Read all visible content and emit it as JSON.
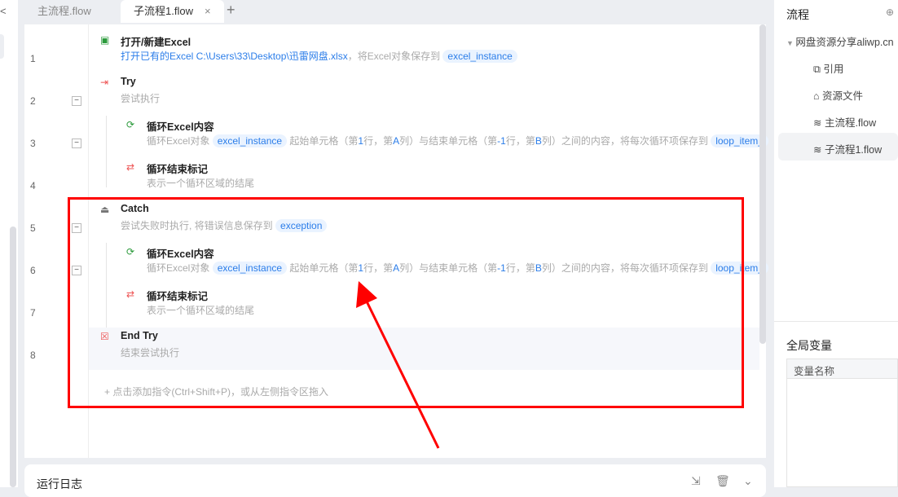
{
  "tabs": [
    {
      "label": "主流程.flow"
    },
    {
      "label": "子流程1.flow",
      "close": "×"
    }
  ],
  "add_tab": "+",
  "back": "<",
  "rows": [
    {
      "n": "1",
      "title": "打开/新建Excel",
      "desc": [
        {
          "t": "打开已有的Excel C:\\Users\\33\\Desktop\\迅雷网盘.xlsx",
          "k": "blue"
        },
        {
          "t": "，将Excel对象保存到 ",
          "k": ""
        },
        {
          "t": "excel_instance",
          "k": "chip"
        }
      ]
    },
    {
      "n": "2",
      "title": "Try",
      "desc": [
        {
          "t": "尝试执行",
          "k": ""
        }
      ]
    },
    {
      "n": "3",
      "title": "循环Excel内容",
      "desc": [
        {
          "t": "循环Excel对象 ",
          "k": ""
        },
        {
          "t": "excel_instance",
          "k": "chip"
        },
        {
          "t": " 起始单元格（第",
          "k": ""
        },
        {
          "t": "1",
          "k": "blue"
        },
        {
          "t": "行，第",
          "k": ""
        },
        {
          "t": "A",
          "k": "blue"
        },
        {
          "t": "列）与结束单元格（第",
          "k": ""
        },
        {
          "t": "-1",
          "k": "blue"
        },
        {
          "t": "行，第",
          "k": ""
        },
        {
          "t": "B",
          "k": "blue"
        },
        {
          "t": "列）之间的内容，将每次循环项保存到 ",
          "k": ""
        },
        {
          "t": "loop_item_",
          "k": "chip"
        }
      ]
    },
    {
      "n": "4",
      "title": "循环结束标记",
      "desc": [
        {
          "t": "表示一个循环区域的结尾",
          "k": ""
        }
      ]
    },
    {
      "n": "5",
      "title": "Catch",
      "desc": [
        {
          "t": "尝试失败时执行, 将错误信息保存到 ",
          "k": ""
        },
        {
          "t": "exception",
          "k": "chip"
        }
      ]
    },
    {
      "n": "6",
      "title": "循环Excel内容",
      "desc": [
        {
          "t": "循环Excel对象 ",
          "k": ""
        },
        {
          "t": "excel_instance",
          "k": "chip"
        },
        {
          "t": " 起始单元格（第",
          "k": ""
        },
        {
          "t": "1",
          "k": "blue"
        },
        {
          "t": "行，第",
          "k": ""
        },
        {
          "t": "A",
          "k": "blue"
        },
        {
          "t": "列）与结束单元格（第",
          "k": ""
        },
        {
          "t": "-1",
          "k": "blue"
        },
        {
          "t": "行，第",
          "k": ""
        },
        {
          "t": "B",
          "k": "blue"
        },
        {
          "t": "列）之间的内容，将每次循环项保存到 ",
          "k": ""
        },
        {
          "t": "loop_item_",
          "k": "chip"
        }
      ]
    },
    {
      "n": "7",
      "title": "循环结束标记",
      "desc": [
        {
          "t": "表示一个循环区域的结尾",
          "k": ""
        }
      ]
    },
    {
      "n": "8",
      "title": "End Try",
      "desc": [
        {
          "t": "结束尝试执行",
          "k": ""
        }
      ]
    }
  ],
  "add_hint": "+  点击添加指令(Ctrl+Shift+P)，或从左侧指令区拖入",
  "log": {
    "title": "运行日志"
  },
  "right": {
    "title": "流程",
    "project": "网盘资源分享aliwp.cn",
    "items": [
      {
        "label": "引用"
      },
      {
        "label": "资源文件"
      },
      {
        "label": "主流程.flow"
      },
      {
        "label": "子流程1.flow"
      }
    ],
    "globals_title": "全局变量",
    "col_header": "变量名称"
  }
}
